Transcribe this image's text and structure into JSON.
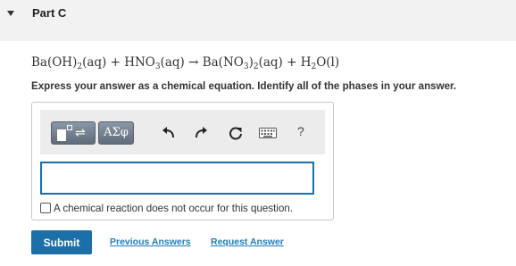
{
  "part": {
    "title": "Part C",
    "collapse_icon": "caret-down-icon"
  },
  "equation": {
    "text": "Ba(OH)2(aq) + HNO3(aq) → Ba(NO3)2(aq) + H2O(l)",
    "segments": {
      "ba": "Ba(OH)",
      "s1": "2",
      "aq1": "(aq) + HNO",
      "s2": "3",
      "aq2": "(aq) → Ba(NO",
      "s3": "3",
      "close": ")",
      "s4": "2",
      "aq3": "(aq) + H",
      "s5": "2",
      "end": "O(l)"
    }
  },
  "instruction": "Express your answer as a chemical equation. Identify all of the phases in your answer.",
  "toolbar": {
    "templates_icon": "templates-icon",
    "greek_label": "ΑΣφ",
    "undo_icon": "undo-icon",
    "redo_icon": "redo-icon",
    "reset_icon": "reset-icon",
    "keyboard_icon": "keyboard-icon",
    "help_label": "?"
  },
  "answer": {
    "value": "",
    "no_reaction_label": "A chemical reaction does not occur for this question.",
    "no_reaction_checked": false
  },
  "actions": {
    "submit_label": "Submit",
    "previous_answers_label": "Previous Answers",
    "request_answer_label": "Request Answer"
  },
  "colors": {
    "accent": "#1d6faa",
    "link": "#1d7cc0",
    "header_bg": "#f2f2f2",
    "toolbar_bg": "#ececec"
  }
}
